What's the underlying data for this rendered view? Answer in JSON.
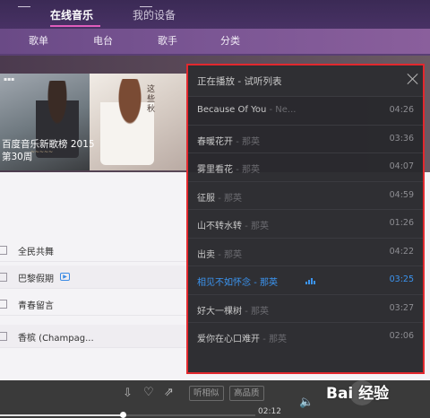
{
  "header": {
    "tabs": [
      {
        "label": "在线音乐",
        "active": true
      },
      {
        "label": "我的设备",
        "active": false
      }
    ]
  },
  "subnav": {
    "items": [
      "歌单",
      "电台",
      "歌手",
      "分类"
    ]
  },
  "banner": {
    "title": "百度音乐新歌榜 2015",
    "subtitle": "第30周",
    "vertical_text": "这些秋"
  },
  "song_list": [
    {
      "name": "全民共舞",
      "mv": false
    },
    {
      "name": "巴黎假期",
      "mv": true
    },
    {
      "name": "青春留言",
      "mv": false
    },
    {
      "name": "香槟 (Champag...",
      "mv": false
    }
  ],
  "playlist_panel": {
    "title": "正在播放 - 试听列表",
    "items": [
      {
        "title": "Because Of You",
        "artist": "- Ne...",
        "duration": "04:26",
        "playing": false
      },
      {
        "title": "春暖花开",
        "artist": "- 那英",
        "duration": "03:36",
        "playing": false
      },
      {
        "title": "雾里看花",
        "artist": "- 那英",
        "duration": "04:07",
        "playing": false
      },
      {
        "title": "征服",
        "artist": "- 那英",
        "duration": "04:59",
        "playing": false
      },
      {
        "title": "山不转水转",
        "artist": "- 那英",
        "duration": "01:26",
        "playing": false
      },
      {
        "title": "出卖",
        "artist": "- 那英",
        "duration": "04:22",
        "playing": false
      },
      {
        "title": "相见不如怀念",
        "artist": "- 那英",
        "duration": "03:25",
        "playing": true
      },
      {
        "title": "好大一棵树",
        "artist": "- 那英",
        "duration": "03:27",
        "playing": false
      },
      {
        "title": "爱你在心口难开",
        "artist": "- 那英",
        "duration": "02:06",
        "playing": false
      }
    ],
    "accent_color": "#3b94f0",
    "highlight_border_color": "#e2282e"
  },
  "player": {
    "similar_label": "听相似",
    "quality_label": "高品质",
    "current_time": "02:12",
    "progress_fraction": 0.48
  },
  "watermark": {
    "text": "Bai 经验"
  },
  "icons": [
    "download-icon",
    "heart-icon",
    "share-icon",
    "volume-icon",
    "close-icon",
    "playing-equalizer-icon"
  ]
}
